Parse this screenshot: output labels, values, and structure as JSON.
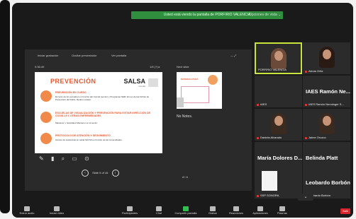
{
  "banner": "Usted está viendo la pantalla de PORFIRIO VALENCIA",
  "view_options": "Opciones de vista ⌄",
  "share_toolbar": {
    "items": [
      "Iniciar grabación",
      "Ocultar presentador",
      "Ver pantalla"
    ]
  },
  "presenter": {
    "time": "0:36:49",
    "slide_counter_top": "1/8 (?) ▸",
    "next_slide_label": "Next slide",
    "no_notes": "No Notes.",
    "slide_status": "Slide 5 of 16",
    "aa": "A^ A"
  },
  "slide": {
    "title": "PREVENCIÓN",
    "brand": "SALSA",
    "brand_sub": "Comité",
    "sections": [
      {
        "heading": "PREVENCIÓN EN CURSO",
        "text": "El curso de los escolares en función del Comité (sector) y Programas SEM.\nEl uso de las Fichas de Prevención del Delito.\nRedes Locales."
      },
      {
        "heading": "ESCUELAS DE VISUALIZACIÓN Y PREVENCIÓN PARA EVITAR INFECCIÓN DE COVID-19 Y OTRAS ENFERMEDADES",
        "text": "Mantener y hospitales\nMantener en el sector."
      },
      {
        "heading": "PROTOCOLO DE ATENCIÓN Y SEGUIMIENTO",
        "text": "Acceso de sustancias en salud SALSA en función de las comunidades."
      }
    ],
    "next_title": "MATERIAS PARA"
  },
  "participants": [
    {
      "name": "PORFIRIO VALENCIA",
      "type": "video",
      "active": true
    },
    {
      "name": "Alexia Ortiz",
      "type": "video",
      "active": false
    },
    {
      "name": "IAES",
      "big": "IAES Ramón Ne...",
      "type": "name",
      "subname": "IAES Ramón Nenninger S..."
    },
    {
      "name": "IAES",
      "type": "text"
    },
    {
      "name": "Daniela Alvarado",
      "type": "video"
    },
    {
      "name": "Jaime Orozco",
      "type": "video"
    },
    {
      "name": "María Dolores DAF IAES",
      "big": "María Dolores D...",
      "type": "name"
    },
    {
      "name": "Belinda Platt",
      "big": "Belinda Platt",
      "type": "name"
    },
    {
      "name": "SSP SONORA",
      "type": "logo"
    },
    {
      "name": "Leobardo Borbón",
      "big": "Leobardo Borbón",
      "type": "name"
    }
  ],
  "bottom": {
    "buttons": [
      "Entrar audio",
      "Iniciar video",
      "Participantes",
      "Chat",
      "Compartir pantalla",
      "Grabar",
      "Reacciones",
      "Aplicaciones",
      "Pizarras"
    ],
    "participants_count": "14",
    "leave": "Salir"
  },
  "colors": {
    "accent": "#e4572e",
    "active_border": "#c9e23c",
    "banner": "#2f8f3f",
    "leave": "#d9252b"
  }
}
